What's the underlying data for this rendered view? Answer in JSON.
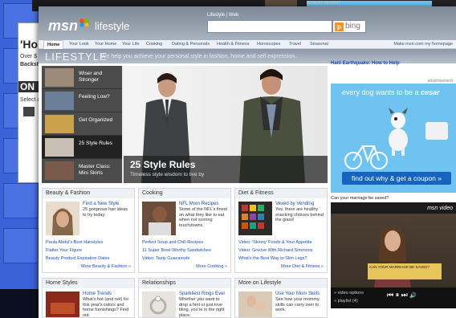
{
  "background": {
    "partial_headline": "'Ho",
    "partial_sub": "Over $",
    "partial_sub2": "Backst",
    "partial_on": "ON",
    "partial_select": "Select a",
    "advertisement_label": "ADVERTISEMENT"
  },
  "masthead": {
    "logo": "msn",
    "section": "lifestyle",
    "search_tabs": "Lifestyle | Web",
    "search_placeholder": "",
    "search_button_brand": "bing"
  },
  "nav": {
    "items": [
      "Home",
      "Your Look",
      "Your Home",
      "Your Life",
      "Cooking",
      "Dating & Personals",
      "Health & Fitness",
      "Horoscopes",
      "Travel",
      "Seasonal"
    ],
    "right_link": "Make msn.com my homepage"
  },
  "banner": {
    "title": "LIFESTYLE",
    "tagline": "We help you achieve your personal style in fashion, home and self expression."
  },
  "feature_menu": [
    {
      "label": "Wiser and Stronger"
    },
    {
      "label": "Feeling Low?"
    },
    {
      "label": "Get Organized"
    },
    {
      "label": "25 Style Rules"
    },
    {
      "label": "Master Class: Mini Skirts"
    }
  ],
  "hero": {
    "title": "25 Style Rules",
    "subtitle": "Timeless style wisdom to live by"
  },
  "cards": [
    {
      "header": "Beauty & Fashion",
      "title": "Find a New Style",
      "blurb": "25 gorgeous hair ideas to try today.",
      "links": [
        "Paula Abdul's Best Hairstyles",
        "Flatter Your Figure",
        "Beauty Product Expiration Dates"
      ],
      "more": "More Beauty & Fashion »"
    },
    {
      "header": "Cooking",
      "title": "NFL Mom Recipes",
      "blurb": "Some of the NFL's finest on what they like to eat when not scoring touchdowns.",
      "links": [
        "Perfect Soup and Chili Recipes",
        "11 Super Bowl-Worthy Sandwiches",
        "Video: Tasty Guacamole"
      ],
      "more": "More Cooking »"
    },
    {
      "header": "Diet & Fitness",
      "title": "Vexed by Vending",
      "blurb": "Yes, there are healthy snacking choices behind the glass!",
      "links": [
        "Video: 'Skinny' Foods & Your Appetite",
        "Video: Groove With Richard Simmons",
        "What's the Best Way to Slim Legs?"
      ],
      "more": "More Diet & Fitness »"
    }
  ],
  "cards_row2": [
    {
      "header": "Home Styles",
      "title": "Home Trends",
      "blurb": "What's hot (and not) for this year's colors and home furnishings? Find out."
    },
    {
      "header": "Relationships",
      "title": "Sparkliest Rings Ever",
      "blurb": "Whether you want to drop a hint or just love bling, you're in the right place."
    },
    {
      "header": "More on Lifestyle",
      "title": "Use Your Mom Skills",
      "blurb": "See how your mommy skills can carry over to work."
    }
  ],
  "right": {
    "news": "Haiti Earthquake: How to Help",
    "ad_label": "advertisement",
    "ad_line": "every dog wants to be a",
    "ad_brand": "cesar",
    "ad_cta": "find out why & get a coupon »",
    "video_title": "Can your marriage be saved?",
    "video_brand": "msn video",
    "video_lower_third": "CAN YOUR MARRIAGE BE SAVED?",
    "video_options": "» video options",
    "playlist": "» playlist (4)"
  }
}
